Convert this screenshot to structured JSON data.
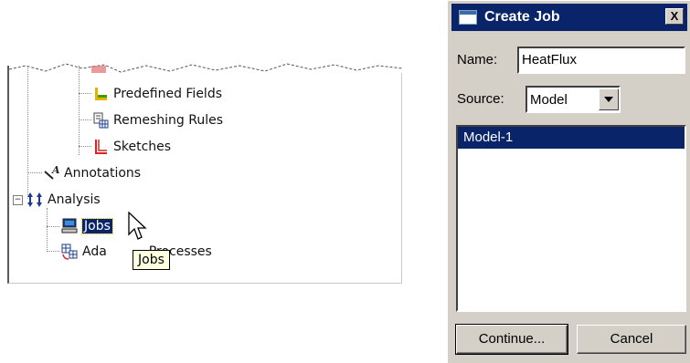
{
  "tree": {
    "items": [
      {
        "label": "Predefined Fields"
      },
      {
        "label": "Remeshing Rules"
      },
      {
        "label": "Sketches"
      },
      {
        "label": "Annotations"
      },
      {
        "label": "Analysis"
      },
      {
        "label": "Jobs"
      },
      {
        "label": "Ada",
        "label_tail": "Processes"
      }
    ],
    "expander_symbol": "⊟",
    "tooltip": "Jobs"
  },
  "dialog": {
    "title": "Create Job",
    "close_label": "X",
    "name_label": "Name:",
    "name_value": "HeatFlux",
    "source_label": "Source:",
    "source_value": "Model",
    "models": [
      "Model-1"
    ],
    "continue_label": "Continue...",
    "cancel_label": "Cancel"
  },
  "colors": {
    "selection": "#0a246a",
    "dialog_face": "#d4d0c8",
    "tooltip_bg": "#ffffe1"
  }
}
